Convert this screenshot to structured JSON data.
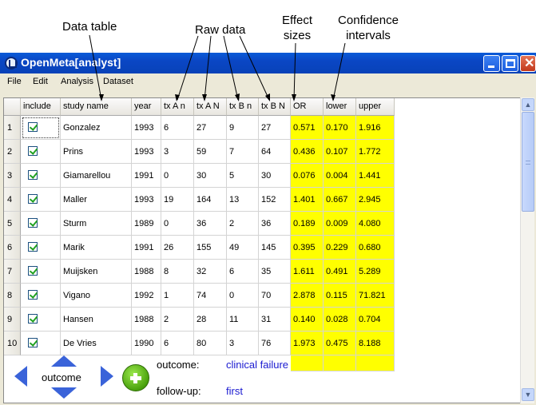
{
  "annotations": {
    "data_table": "Data table",
    "raw_data": "Raw data",
    "effect_sizes": [
      "Effect",
      "sizes"
    ],
    "confidence_intervals": [
      "Confidence",
      "intervals"
    ]
  },
  "window": {
    "title": "OpenMeta[analyst]",
    "menu": [
      "File",
      "Edit",
      "Analysis",
      "Dataset"
    ]
  },
  "table": {
    "columns": [
      "include",
      "study name",
      "year",
      "tx A n",
      "tx A N",
      "tx B n",
      "tx B N",
      "OR",
      "lower",
      "upper"
    ],
    "rows": [
      {
        "num": "1",
        "include": true,
        "study": "Gonzalez",
        "year": "1993",
        "txAn": "6",
        "txAN": "27",
        "txBn": "9",
        "txBN": "27",
        "or": "0.571",
        "lower": "0.170",
        "upper": "1.916"
      },
      {
        "num": "2",
        "include": true,
        "study": "Prins",
        "year": "1993",
        "txAn": "3",
        "txAN": "59",
        "txBn": "7",
        "txBN": "64",
        "or": "0.436",
        "lower": "0.107",
        "upper": "1.772"
      },
      {
        "num": "3",
        "include": true,
        "study": "Giamarellou",
        "year": "1991",
        "txAn": "0",
        "txAN": "30",
        "txBn": "5",
        "txBN": "30",
        "or": "0.076",
        "lower": "0.004",
        "upper": "1.441"
      },
      {
        "num": "4",
        "include": true,
        "study": "Maller",
        "year": "1993",
        "txAn": "19",
        "txAN": "164",
        "txBn": "13",
        "txBN": "152",
        "or": "1.401",
        "lower": "0.667",
        "upper": "2.945"
      },
      {
        "num": "5",
        "include": true,
        "study": "Sturm",
        "year": "1989",
        "txAn": "0",
        "txAN": "36",
        "txBn": "2",
        "txBN": "36",
        "or": "0.189",
        "lower": "0.009",
        "upper": "4.080"
      },
      {
        "num": "6",
        "include": true,
        "study": "Marik",
        "year": "1991",
        "txAn": "26",
        "txAN": "155",
        "txBn": "49",
        "txBN": "145",
        "or": "0.395",
        "lower": "0.229",
        "upper": "0.680"
      },
      {
        "num": "7",
        "include": true,
        "study": "Muijsken",
        "year": "1988",
        "txAn": "8",
        "txAN": "32",
        "txBn": "6",
        "txBN": "35",
        "or": "1.611",
        "lower": "0.491",
        "upper": "5.289"
      },
      {
        "num": "8",
        "include": true,
        "study": "Vigano",
        "year": "1992",
        "txAn": "1",
        "txAN": "74",
        "txBn": "0",
        "txBN": "70",
        "or": "2.878",
        "lower": "0.115",
        "upper": "71.821"
      },
      {
        "num": "9",
        "include": true,
        "study": "Hansen",
        "year": "1988",
        "txAn": "2",
        "txAN": "28",
        "txBn": "11",
        "txBN": "31",
        "or": "0.140",
        "lower": "0.028",
        "upper": "0.704"
      },
      {
        "num": "10",
        "include": true,
        "study": "De Vries",
        "year": "1990",
        "txAn": "6",
        "txAN": "80",
        "txBn": "3",
        "txBN": "76",
        "or": "1.973",
        "lower": "0.475",
        "upper": "8.188"
      }
    ]
  },
  "controls": {
    "outcome_nav_label": "outcome",
    "outcome_label": "outcome:",
    "outcome_value": "clinical failure",
    "followup_label": "follow-up:",
    "followup_value": "first"
  },
  "colors": {
    "highlight": "#ffff00",
    "value_text": "#1a1ad0",
    "titlebar": "#0a46c4"
  }
}
